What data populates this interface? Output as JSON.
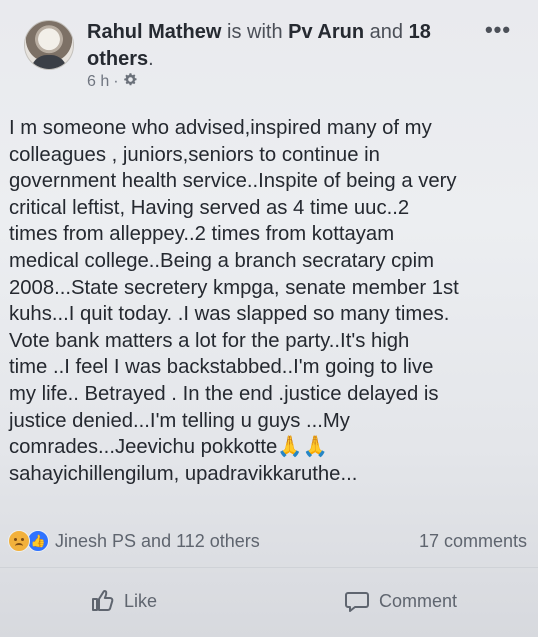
{
  "post": {
    "author": "Rahul Mathew",
    "is_with": "is with",
    "tagged_name": "Pv Arun",
    "and_text": "and",
    "others_count_text": "18 others",
    "period": ".",
    "time": "6 h",
    "separator": "·",
    "privacy_icon": "gear-icon",
    "more_icon_text": "•••",
    "body": "I m someone who advised,inspired many of my\ncolleagues , juniors,seniors to continue in\ngovernment health service..Inspite of being a very\ncritical leftist, Having served as 4 time uuc..2\ntimes from alleppey..2 times from kottayam\nmedical college..Being a branch secratary cpim\n2008...State secretery kmpga, senate member 1st\nkuhs...I quit today. .I was slapped so many times.\nVote bank matters a lot for the party..It's high\ntime ..I feel I was backstabbed..I'm going to live\nmy life.. Betrayed . In the end .justice delayed is\njustice denied...I'm telling u guys ...My\ncomrades...Jeevichu pokkotte🙏🙏\nsahayichillengilum, upadravikkaruthe..."
  },
  "reactions": {
    "summary": "Jinesh PS and 112 others",
    "comments": "17 comments",
    "icons": [
      "sad-reaction-icon",
      "like-reaction-icon"
    ]
  },
  "actions": {
    "like_label": "Like",
    "comment_label": "Comment"
  },
  "colors": {
    "like_blue": "#2f73ff",
    "sad_yellow": "#f2b13c",
    "text": "#262a31",
    "muted": "#5f656f"
  }
}
